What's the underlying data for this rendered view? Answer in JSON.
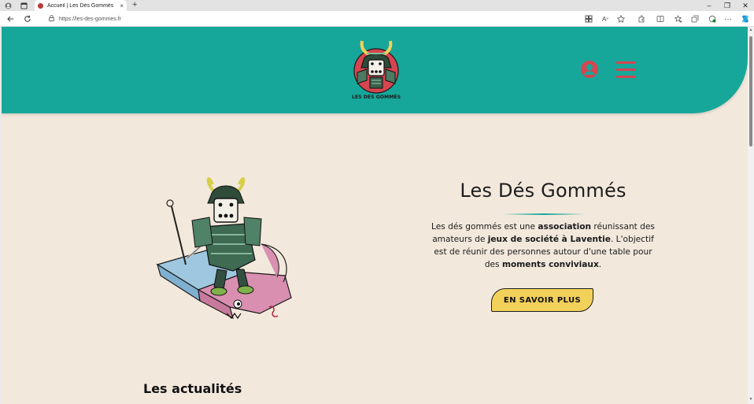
{
  "browser": {
    "tab_title": "Accueil | Les Dés Gommés",
    "tab_close": "×",
    "new_tab": "+",
    "url": "https://les-des-gommes.fr",
    "window_controls": [
      "–",
      "❐",
      "✕"
    ]
  },
  "header": {
    "logo_text": "LES DÉS GOMMÉS",
    "colors": {
      "teal": "#17a79a",
      "red": "#d64550"
    }
  },
  "hero": {
    "title": "Les Dés Gommés",
    "text_parts": [
      "Les dés gommés est une ",
      "association",
      " réunissant des amateurs de ",
      "jeux de société à Laventie",
      ". L'objectif est de réunir des personnes autour d'une table pour des ",
      "moments conviviaux",
      "."
    ],
    "cta_label": "EN SAVOIR PLUS",
    "cta_color": "#f2d15a"
  },
  "news": {
    "title": "Les actualités"
  },
  "icons": [
    "profile-icon",
    "tabs-icon",
    "back-icon",
    "reload-icon",
    "lock-icon",
    "read-aloud-icon",
    "favorites-icon",
    "user-icon",
    "hamburger-icon"
  ]
}
